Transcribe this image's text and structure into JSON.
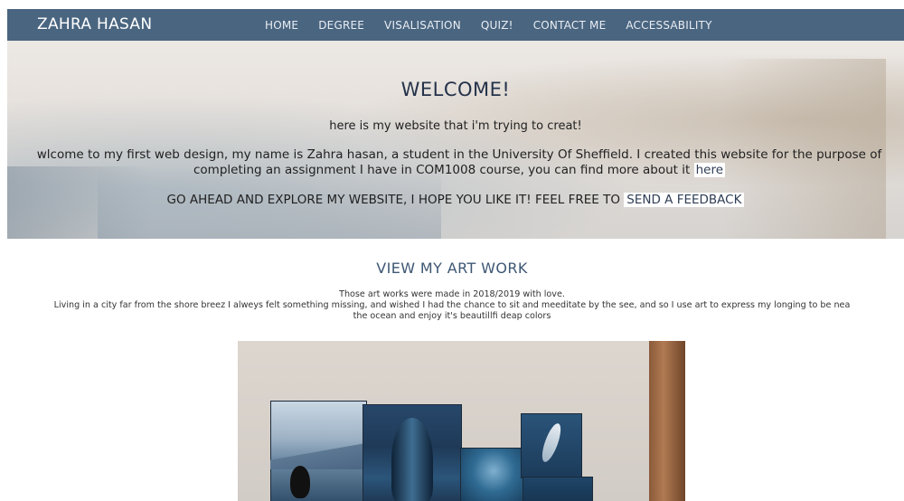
{
  "navbar": {
    "brand": "ZAHRA HASAN",
    "links": [
      "HOME",
      "DEGREE",
      "VISALISATION",
      "QUIZ!",
      "CONTACT ME",
      "ACCESSABILITY"
    ],
    "background": "#4a6580"
  },
  "hero": {
    "title": "WELCOME!",
    "subtitle": "here is my website that i'm trying to creat!",
    "paragraph": "wlcome to my first web design, my name is Zahra hasan, a student in the University Of Sheffield. I created this website for the purpose of completing an assignment I have in COM1008 course, you can find more about it",
    "paragraph_link": "here",
    "cta_text": "GO AHEAD AND EXPLORE MY WEBSITE, I HOPE YOU LIKE IT! FEEL FREE TO",
    "cta_link": "SEND A FEEDBACK"
  },
  "art": {
    "title": "VIEW MY ART WORK",
    "desc_line1": "Those art works were made in 2018/2019 with love.",
    "desc_line2": "Living in a city far from the shore breez I alweys felt something missing, and wished I had the chance to sit and meeditate by the see, and so I use art to express my longing to be nea",
    "desc_line3": "the ocean and enjoy it's beautillfi deap colors",
    "accent": "#3e5773"
  }
}
